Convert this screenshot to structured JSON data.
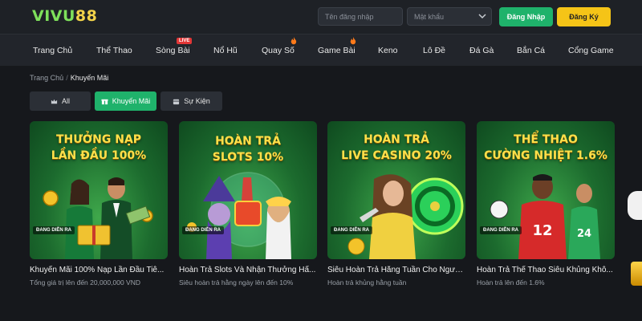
{
  "header": {
    "logo_part1": "VIVU",
    "logo_part2": "88",
    "username_placeholder": "Tên đăng nhập",
    "password_placeholder": "Mật khẩu",
    "login_label": "Đăng Nhập",
    "register_label": "Đăng Ký",
    "colors": {
      "login": "#1fb26b",
      "register": "#f5c417"
    }
  },
  "nav": {
    "items": [
      {
        "label": "Trang Chủ"
      },
      {
        "label": "Thể Thao"
      },
      {
        "label": "Sòng Bài",
        "badge": "LIVE"
      },
      {
        "label": "Nổ Hũ"
      },
      {
        "label": "Quay Số",
        "icon": "fire-icon"
      },
      {
        "label": "Game Bài",
        "icon": "fire-icon"
      },
      {
        "label": "Keno"
      },
      {
        "label": "Lô Đề"
      },
      {
        "label": "Đá Gà"
      },
      {
        "label": "Bắn Cá"
      },
      {
        "label": "Cổng Game"
      }
    ]
  },
  "breadcrumb": {
    "home": "Trang Chủ",
    "separator": "/",
    "current": "Khuyến Mãi"
  },
  "filters": [
    {
      "label": "All",
      "icon": "crown-icon",
      "active": false
    },
    {
      "label": "Khuyến Mãi",
      "icon": "gift-icon",
      "active": true
    },
    {
      "label": "Sự Kiện",
      "icon": "calendar-icon",
      "active": false
    }
  ],
  "promotions": [
    {
      "banner_line1": "THƯỞNG NẠP",
      "banner_line2": "LẦN ĐẦU 100%",
      "badge": "ĐANG DIỄN RA",
      "title": "Khuyến Mãi 100% Nạp Lần Đầu Tiê...",
      "subtitle": "Tổng giá trị lên đến 20,000,000 VND"
    },
    {
      "banner_line1": "HOÀN TRẢ",
      "banner_line2": "SLOTS 10%",
      "badge": "ĐANG DIỄN RA",
      "title": "Hoàn Trả Slots Và Nhận Thưởng Hấ...",
      "subtitle": "Siêu hoàn trả hằng ngày lên đến 10%"
    },
    {
      "banner_line1": "HOÀN TRẢ",
      "banner_line2": "LIVE CASINO 20%",
      "badge": "ĐANG DIỄN RA",
      "title": "Siêu Hoàn Trả Hằng Tuần Cho Ngườ...",
      "subtitle": "Hoàn trả khủng hằng tuần"
    },
    {
      "banner_line1": "THỂ THAO",
      "banner_line2": "CƯỜNG NHIỆT 1.6%",
      "badge": "ĐANG DIỄN RA",
      "title": "Hoàn Trả Thể Thao Siêu Khủng Khô...",
      "subtitle": "Hoàn trả lên đến 1.6%"
    }
  ]
}
